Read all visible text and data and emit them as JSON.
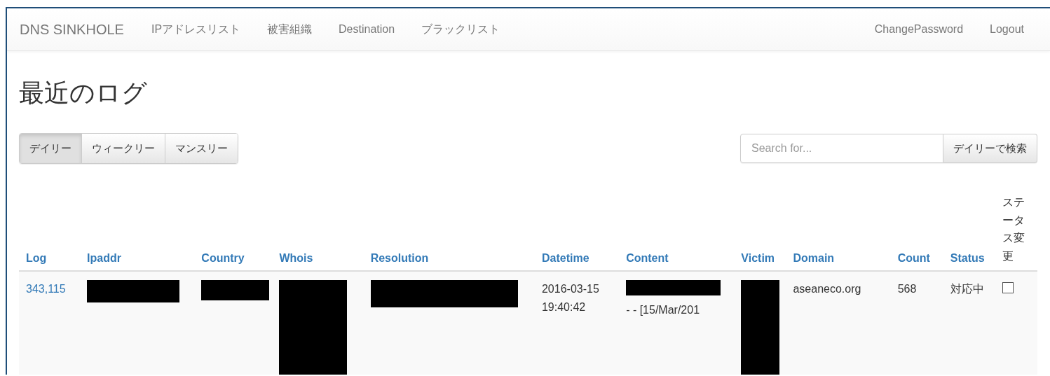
{
  "navbar": {
    "brand": "DNS SINKHOLE",
    "links": [
      "IPアドレスリスト",
      "被害組織",
      "Destination",
      "ブラックリスト"
    ],
    "right_links": [
      "ChangePassword",
      "Logout"
    ]
  },
  "heading": "最近のログ",
  "period_tabs": [
    {
      "label": "デイリー",
      "selected": true
    },
    {
      "label": "ウィークリー",
      "selected": false
    },
    {
      "label": "マンスリー",
      "selected": false
    }
  ],
  "search": {
    "placeholder": "Search for...",
    "button": "デイリーで検索"
  },
  "table": {
    "columns": [
      "Log",
      "Ipaddr",
      "Country",
      "Whois",
      "Resolution",
      "Datetime",
      "Content",
      "Victim",
      "Domain",
      "Count",
      "Status",
      "ステータス変更"
    ],
    "rows": [
      {
        "cells": [
          {
            "kind": "link",
            "text": "343,115"
          },
          {
            "kind": "redacted"
          },
          {
            "kind": "redacted"
          },
          {
            "kind": "redacted"
          },
          {
            "kind": "redacted"
          },
          {
            "kind": "text",
            "text": "2016-03-15 19:40:42"
          },
          {
            "kind": "redacted_text",
            "text": "- - [15/Mar/201"
          },
          {
            "kind": "redacted"
          },
          {
            "kind": "text",
            "text": "aseaneco.org"
          },
          {
            "kind": "text",
            "text": "568"
          },
          {
            "kind": "text",
            "text": "対応中"
          },
          {
            "kind": "checkbox",
            "checked": false
          }
        ]
      }
    ]
  }
}
